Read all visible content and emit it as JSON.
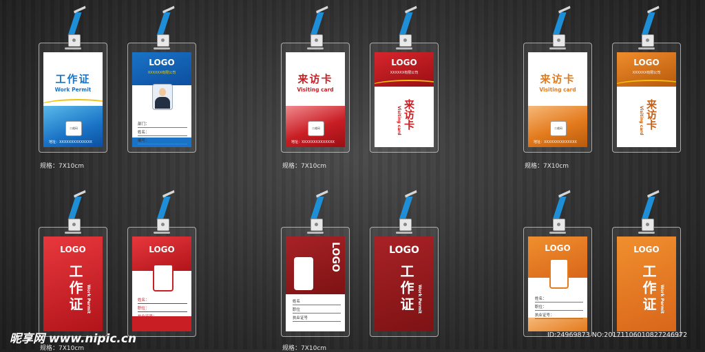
{
  "spec_label": "规格：7X10cm",
  "spec_label_cut": "规格：7X10cm",
  "row1": {
    "blue": {
      "front": {
        "title": "工作证",
        "subtitle": "Work Permit",
        "qr": "二维码",
        "address": "地址：XXXXXXXXXXXXXX"
      },
      "back": {
        "logo": "LOGO",
        "company": "XXXXXX有限公司",
        "fields": [
          "部门：",
          "姓名：",
          "编号："
        ]
      }
    },
    "red": {
      "front": {
        "title": "来访卡",
        "subtitle": "Visiting card",
        "qr": "二维码",
        "address": "地址：XXXXXXXXXXXXXX"
      },
      "back": {
        "logo": "LOGO",
        "company": "XXXXXX有限公司",
        "vertical_title": "来访卡",
        "vertical_sub": "Visiting card"
      }
    },
    "orange": {
      "front": {
        "title": "来访卡",
        "subtitle": "Visiting card",
        "qr": "二维码",
        "address": "地址：XXXXXXXXXXXXXX"
      },
      "back": {
        "logo": "LOGO",
        "company": "XXXXXX有限公司",
        "vertical_title": "来访卡",
        "vertical_sub": "Visiting card"
      }
    }
  },
  "row2": {
    "red": {
      "front": {
        "logo": "LOGO",
        "title": "工作证",
        "vertical_sub": "Work Permit"
      },
      "back": {
        "logo": "LOGO",
        "fields": [
          "姓名：",
          "职位：",
          "执业证号："
        ]
      }
    },
    "darkred": {
      "front": {
        "logo": "LOGO",
        "fields": [
          "姓名",
          "职位",
          "执业证号"
        ]
      },
      "back": {
        "logo": "LOGO",
        "title": "工作证",
        "vertical_sub": "Work Permit"
      }
    },
    "orange": {
      "front": {
        "logo": "LOGO",
        "fields": [
          "姓名：",
          "职位：",
          "执业证号："
        ]
      },
      "back": {
        "logo": "LOGO",
        "title": "工作证",
        "vertical_sub": "Work Permit"
      }
    }
  },
  "watermark": {
    "site": "昵享网 www.nipic.cn",
    "id": "ID:24969873 NO:20171106010827246972"
  },
  "colors": {
    "blue": "#1a73c6",
    "red": "#c81e24",
    "darkred": "#8f1a1c",
    "orange": "#e37a1d"
  }
}
